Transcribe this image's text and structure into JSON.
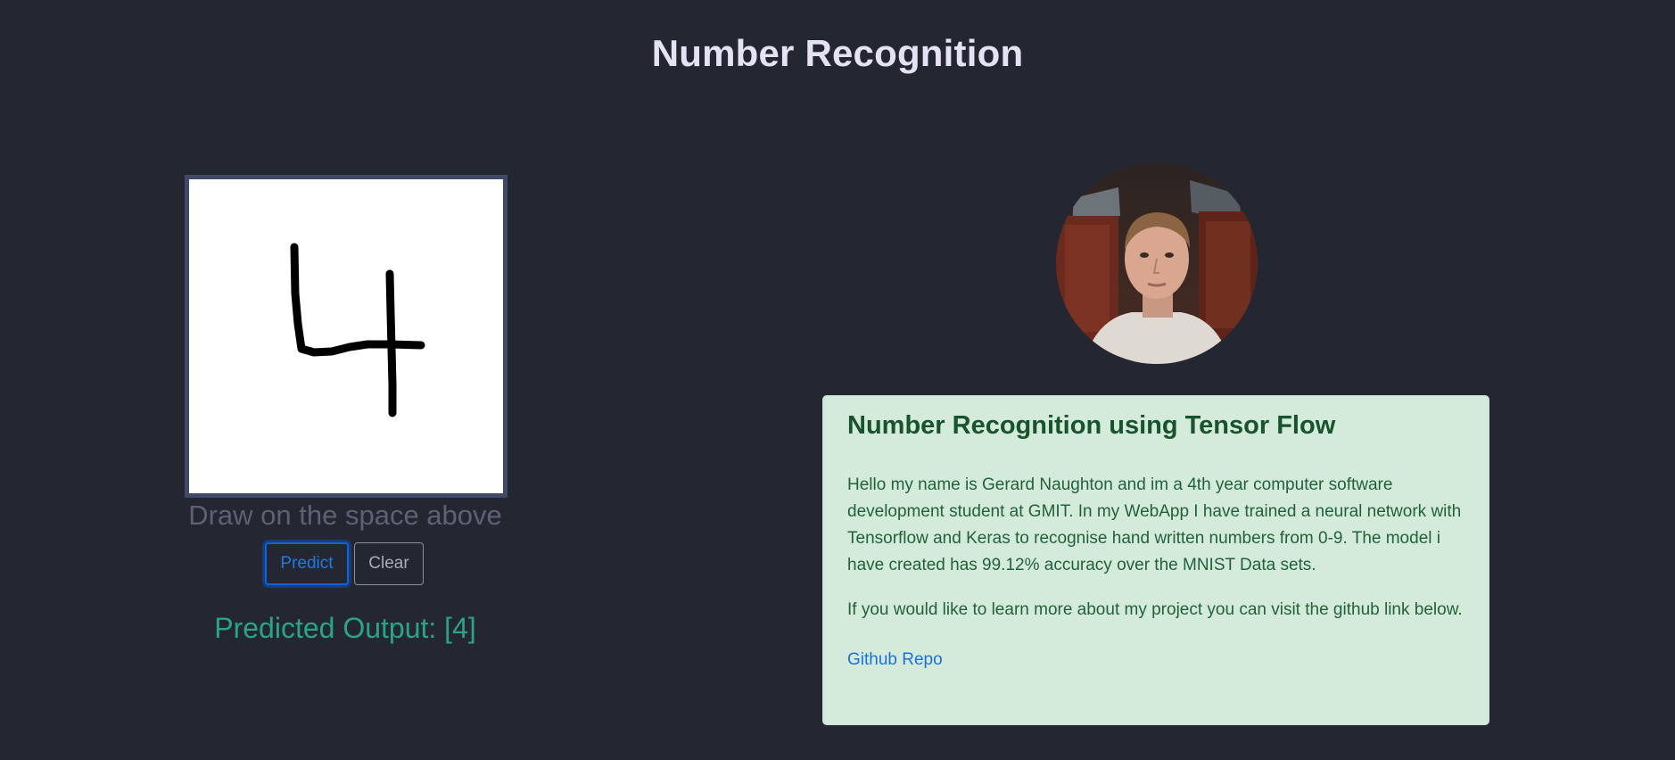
{
  "header": {
    "title": "Number Recognition"
  },
  "drawing": {
    "hint": "Draw on the space above",
    "predict_label": "Predict",
    "clear_label": "Clear",
    "prediction_text": "Predicted Output: [4]"
  },
  "about": {
    "heading": "Number Recognition using Tensor Flow",
    "paragraph1": "Hello my name is Gerard Naughton and im a 4th year computer software development student at GMIT. In my WebApp I have trained a neural network with Tensorflow and Keras to recognise hand written numbers from 0-9. The model i have created has 99.12% accuracy over the MNIST Data sets.",
    "paragraph2": "If you would like to learn more about my project you can visit the github link below.",
    "link_label": "Github Repo"
  },
  "colors": {
    "background": "#242731",
    "card": "#d4ebdc",
    "accent": "#1f7ae6",
    "prediction": "#2aa38a"
  }
}
